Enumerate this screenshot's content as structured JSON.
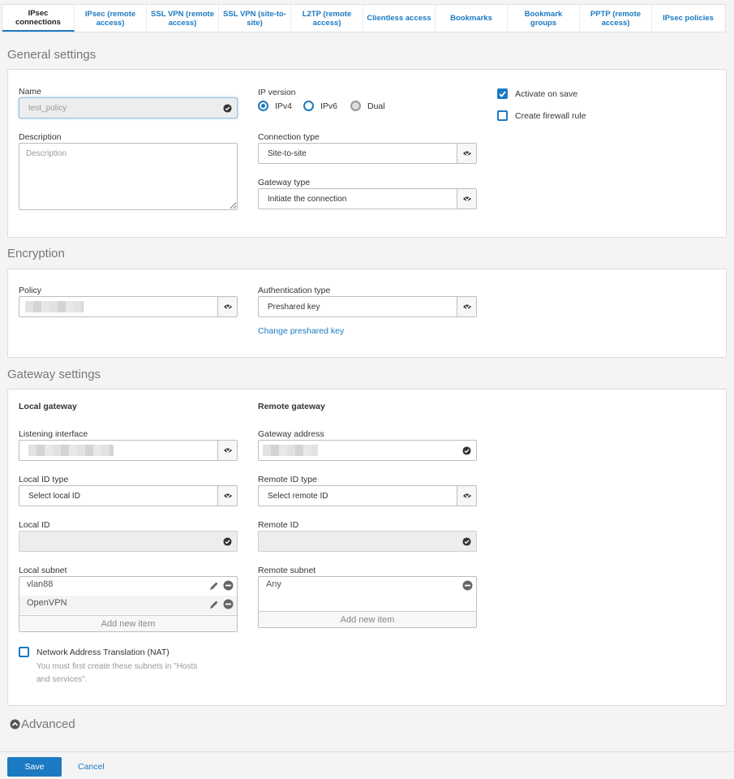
{
  "tabs": [
    {
      "label": "IPsec connections",
      "active": true
    },
    {
      "label": "IPsec (remote access)"
    },
    {
      "label": "SSL VPN (remote access)"
    },
    {
      "label": "SSL VPN (site-to-site)"
    },
    {
      "label": "L2TP (remote access)"
    },
    {
      "label": "Clientless access"
    },
    {
      "label": "Bookmarks"
    },
    {
      "label": "Bookmark groups"
    },
    {
      "label": "PPTP (remote access)"
    },
    {
      "label": "IPsec policies"
    }
  ],
  "general": {
    "title": "General settings",
    "name_label": "Name",
    "name_value": "test_policy",
    "description_label": "Description",
    "description_placeholder": "Description",
    "ip_version_label": "IP version",
    "ip_options": [
      "IPv4",
      "IPv6",
      "Dual"
    ],
    "ip_selected": "IPv4",
    "connection_type_label": "Connection type",
    "connection_type_value": "Site-to-site",
    "gateway_type_label": "Gateway type",
    "gateway_type_value": "Initiate the connection",
    "activate_on_save": "Activate on save",
    "create_firewall_rule": "Create firewall rule"
  },
  "encryption": {
    "title": "Encryption",
    "policy_label": "Policy",
    "auth_type_label": "Authentication type",
    "auth_type_value": "Preshared key",
    "change_key_link": "Change preshared key"
  },
  "gateway": {
    "title": "Gateway settings",
    "local_heading": "Local gateway",
    "remote_heading": "Remote gateway",
    "listening_interface_label": "Listening interface",
    "gateway_address_label": "Gateway address",
    "local_id_type_label": "Local ID type",
    "local_id_type_value": "Select local ID",
    "remote_id_type_label": "Remote ID type",
    "remote_id_type_value": "Select remote ID",
    "local_id_label": "Local ID",
    "remote_id_label": "Remote ID",
    "local_subnet_label": "Local subnet",
    "local_subnets": [
      "vlan88",
      "OpenVPN"
    ],
    "remote_subnet_label": "Remote subnet",
    "remote_subnets": [
      "Any"
    ],
    "add_new_item": "Add new item",
    "nat_label": "Network Address Translation (NAT)",
    "nat_hint_1": "You must first create these subnets in \"Hosts",
    "nat_hint_2": "and services\"."
  },
  "advanced_label": "Advanced",
  "footer": {
    "save": "Save",
    "cancel": "Cancel"
  },
  "colors": {
    "accent": "#1b7ac2",
    "panel_bg": "#ffffff",
    "page_bg": "#f4f4f4"
  }
}
